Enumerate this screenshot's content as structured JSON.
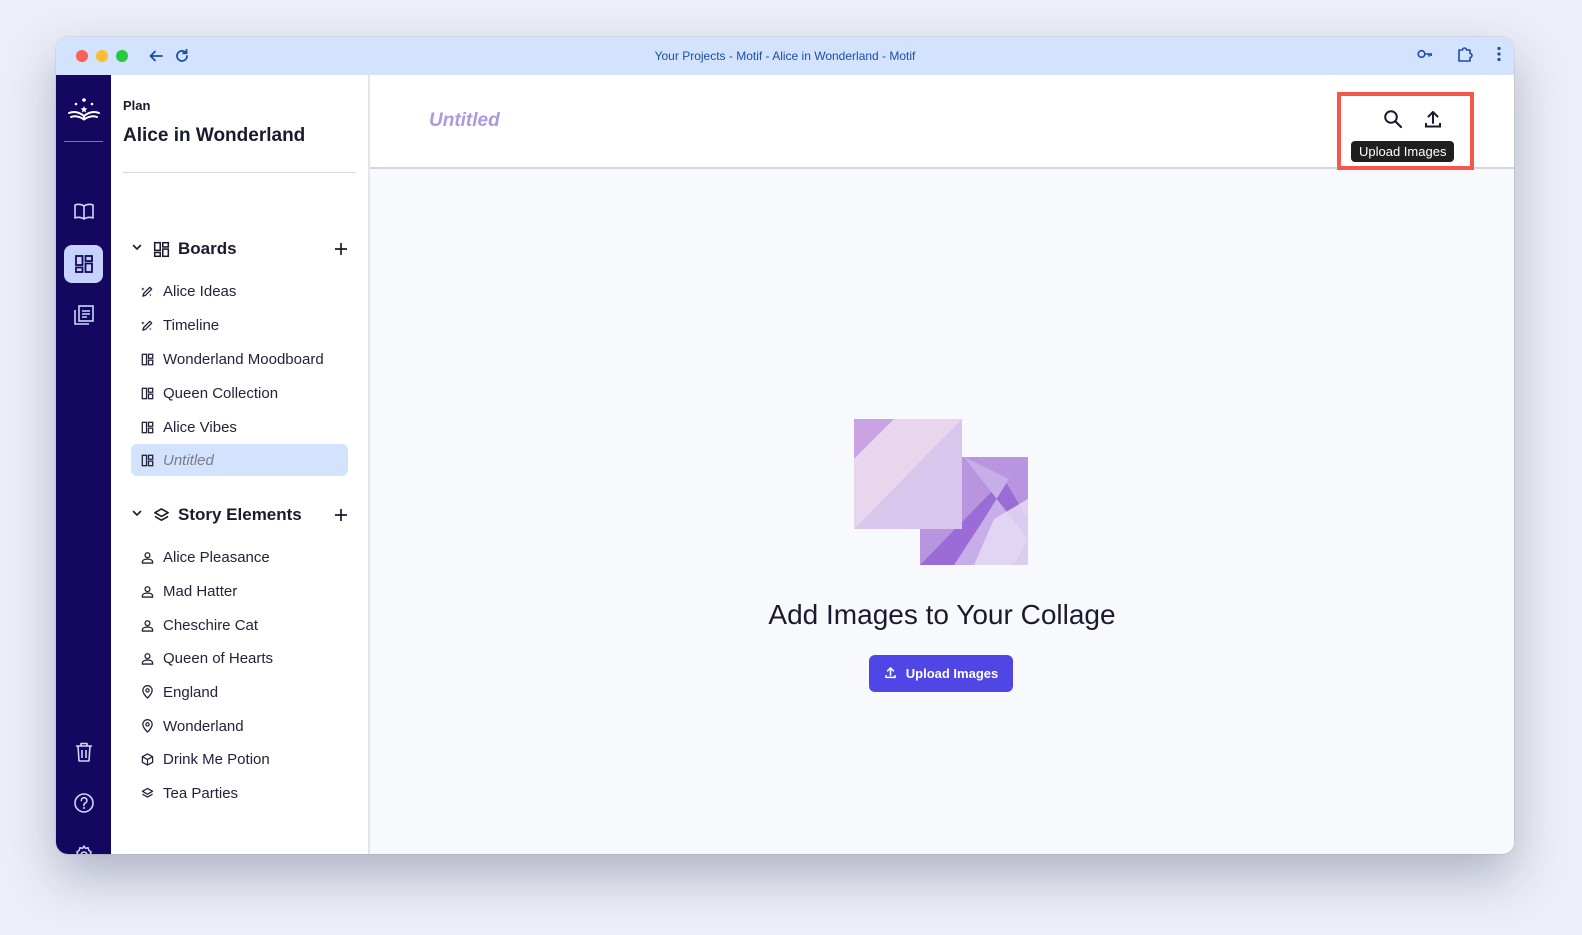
{
  "browser": {
    "title": "Your Projects - Motif - Alice in Wonderland - Motif"
  },
  "sidebar": {
    "eyebrow": "Plan",
    "project_title": "Alice in Wonderland",
    "boards": {
      "label": "Boards",
      "items": [
        {
          "label": "Alice Ideas",
          "icon": "pencil-sparkle-icon"
        },
        {
          "label": "Timeline",
          "icon": "pencil-sparkle-icon"
        },
        {
          "label": "Wonderland Moodboard",
          "icon": "board-icon"
        },
        {
          "label": "Queen Collection",
          "icon": "board-icon"
        },
        {
          "label": "Alice Vibes",
          "icon": "board-icon"
        },
        {
          "label": "Untitled",
          "icon": "board-icon",
          "selected": true
        }
      ]
    },
    "story_elements": {
      "label": "Story Elements",
      "items": [
        {
          "label": "Alice Pleasance",
          "icon": "person-icon"
        },
        {
          "label": "Mad Hatter",
          "icon": "person-icon"
        },
        {
          "label": "Cheschire Cat",
          "icon": "person-icon"
        },
        {
          "label": "Queen of Hearts",
          "icon": "person-icon"
        },
        {
          "label": "England",
          "icon": "location-pin-icon"
        },
        {
          "label": "Wonderland",
          "icon": "location-pin-icon"
        },
        {
          "label": "Drink Me Potion",
          "icon": "cube-icon"
        },
        {
          "label": "Tea Parties",
          "icon": "layers-icon"
        }
      ]
    }
  },
  "main": {
    "board_title": "Untitled",
    "tooltip": "Upload Images",
    "empty_title": "Add Images to Your Collage",
    "upload_button": "Upload Images"
  },
  "colors": {
    "rail": "#14075f",
    "accent": "#4f46e5",
    "selected": "#d3e3fd",
    "highlight_box": "#f4584c"
  }
}
